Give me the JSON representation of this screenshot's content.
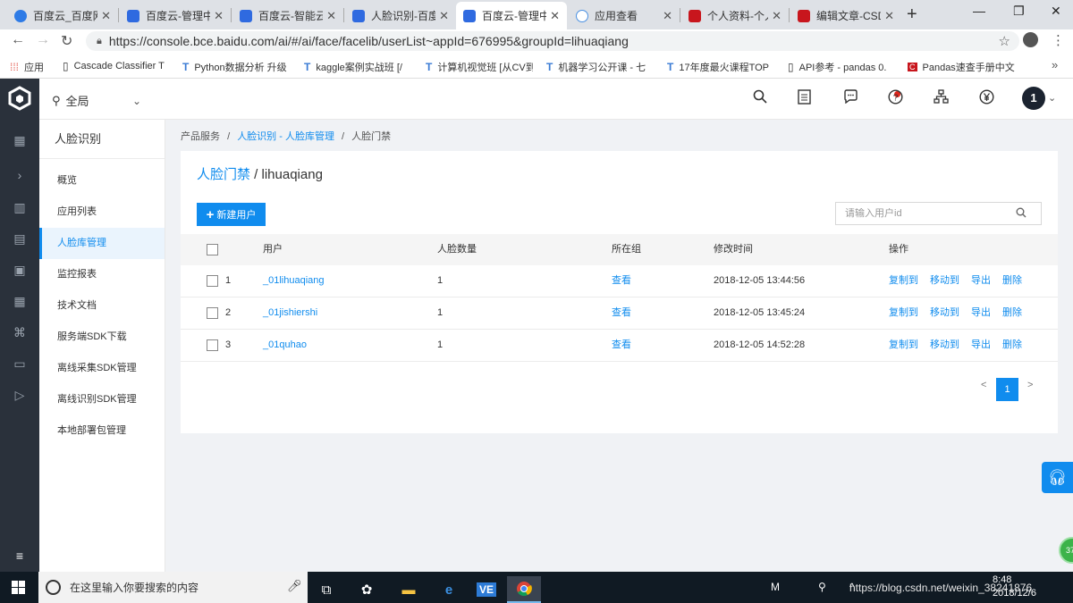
{
  "browser": {
    "tabs": [
      {
        "title": "百度云_百度网",
        "icon_color": "#2e7be6"
      },
      {
        "title": "百度云-管理中",
        "icon_color": "#2f6ae0"
      },
      {
        "title": "百度云-智能云",
        "icon_color": "#2f6ae0"
      },
      {
        "title": "人脸识别-百度",
        "icon_color": "#2f6ae0"
      },
      {
        "title": "百度云-管理中",
        "icon_color": "#2f6ae0"
      },
      {
        "title": "应用查看",
        "icon_color": "#4a90e2"
      },
      {
        "title": "个人资料-个人",
        "icon_color": "#c8161d"
      },
      {
        "title": "编辑文章-CSD",
        "icon_color": "#c8161d"
      }
    ],
    "active_tab_index": 4,
    "url": "https://console.bce.baidu.com/ai/#/ai/face/facelib/userList~appId=676995&groupId=lihuaqiang",
    "bookmarks": [
      {
        "label": "应用",
        "icon": "apps-grid-icon"
      },
      {
        "label": "Cascade Classifier T",
        "icon": "document-icon"
      },
      {
        "label": "Python数据分析 升级",
        "icon": "bookmark-t-icon"
      },
      {
        "label": "kaggle案例实战班 [/",
        "icon": "bookmark-t-icon"
      },
      {
        "label": "计算机视觉班 [从CV到",
        "icon": "bookmark-t-icon"
      },
      {
        "label": "机器学习公开课 - 七",
        "icon": "bookmark-t-icon"
      },
      {
        "label": "17年度最火课程TOP",
        "icon": "bookmark-t-icon"
      },
      {
        "label": "API参考 - pandas 0.",
        "icon": "document-icon"
      },
      {
        "label": "Pandas速查手册中文",
        "icon": "csdn-icon"
      }
    ]
  },
  "console": {
    "region_label": "全局",
    "user_initial": "1",
    "product_title": "人脸识别",
    "sidebar_items": [
      {
        "label": "概览"
      },
      {
        "label": "应用列表"
      },
      {
        "label": "人脸库管理"
      },
      {
        "label": "监控报表"
      },
      {
        "label": "技术文档"
      },
      {
        "label": "服务端SDK下载"
      },
      {
        "label": "离线采集SDK管理"
      },
      {
        "label": "离线识别SDK管理"
      },
      {
        "label": "本地部署包管理"
      }
    ],
    "active_sidebar_index": 2,
    "breadcrumb": {
      "root": "产品服务",
      "sep1": "/",
      "middle": "人脸识别 - 人脸库管理",
      "sep2": "/",
      "current": "人脸门禁"
    },
    "page_title": {
      "link": "人脸门禁",
      "rest": " / lihuaqiang"
    },
    "new_user_button": "新建用户",
    "search_placeholder": "请输入用户id",
    "table": {
      "headers": [
        "用户",
        "人脸数量",
        "所在组",
        "修改时间",
        "操作"
      ],
      "rows": [
        {
          "index": "1",
          "user": "_01lihuaqiang",
          "faces": "1",
          "group": "查看",
          "time": "2018-12-05 13:44:56"
        },
        {
          "index": "2",
          "user": "_01jishiershi",
          "faces": "1",
          "group": "查看",
          "time": "2018-12-05 13:45:24"
        },
        {
          "index": "3",
          "user": "_01quhao",
          "faces": "1",
          "group": "查看",
          "time": "2018-12-05 14:52:28"
        }
      ],
      "actions": [
        "复制到",
        "移动到",
        "导出",
        "删除"
      ]
    },
    "pager": {
      "prev": "<",
      "current": "1",
      "next": ">"
    },
    "float_badge": "37"
  },
  "taskbar": {
    "search_placeholder": "在这里输入你要搜索的内容",
    "time": "8:48",
    "date": "2018/12/6",
    "watermark": "https://blog.csdn.net/weixin_38241876"
  }
}
